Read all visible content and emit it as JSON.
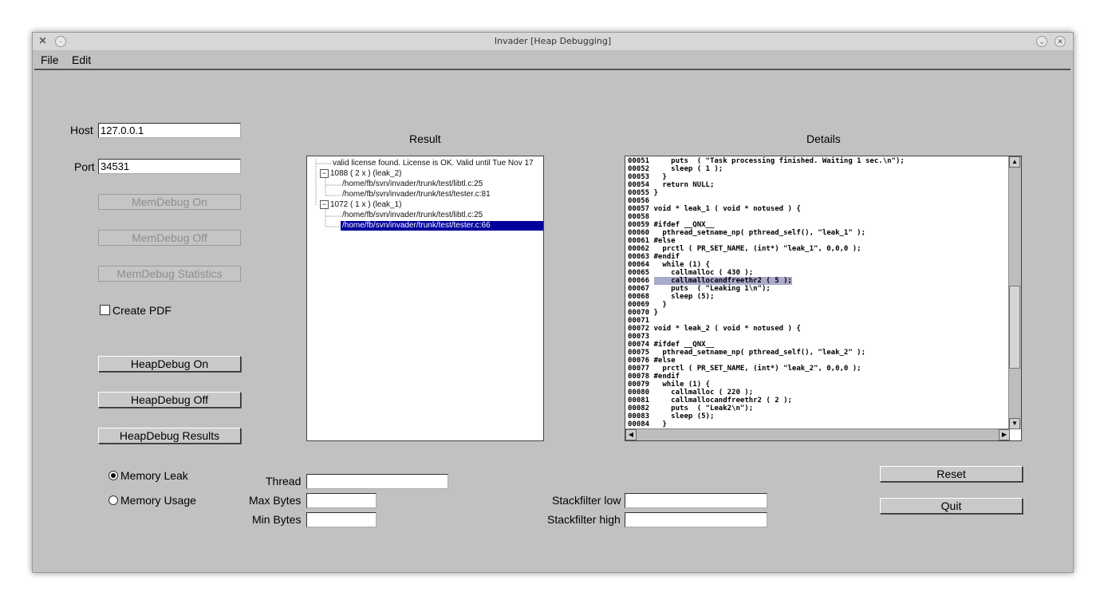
{
  "window": {
    "title": "Invader [Heap Debugging]"
  },
  "menu": {
    "file": "File",
    "edit": "Edit"
  },
  "connection": {
    "host_label": "Host",
    "host_value": "127.0.0.1",
    "port_label": "Port",
    "port_value": "34531"
  },
  "buttons": {
    "memdebug_on": "MemDebug On",
    "memdebug_off": "MemDebug Off",
    "memdebug_stats": "MemDebug Statistics",
    "heapdebug_on": "HeapDebug On",
    "heapdebug_off": "HeapDebug Off",
    "heapdebug_results": "HeapDebug Results",
    "reset": "Reset",
    "quit": "Quit"
  },
  "create_pdf": {
    "label": "Create PDF",
    "checked": false
  },
  "result": {
    "header": "Result",
    "rows": [
      "valid license found.  License is OK. Valid until Tue Nov 17",
      "1088 ( 2 x ) (leak_2)",
      "/home/fb/svn/invader/trunk/test/libtl.c:25",
      "/home/fb/svn/invader/trunk/test/tester.c:81",
      "1072 ( 1 x ) (leak_1)",
      "/home/fb/svn/invader/trunk/test/libtl.c:25",
      "/home/fb/svn/invader/trunk/test/tester.c:66"
    ],
    "toggle_collapse": "−"
  },
  "details": {
    "header": "Details",
    "lines": [
      "00051     puts  ( \"Task processing finished. Waiting 1 sec.\\n\");",
      "00052     sleep ( 1 );",
      "00053   }",
      "00054   return NULL;",
      "00055 }",
      "00056",
      "00057 void * leak_1 ( void * notused ) {",
      "00058",
      "00059 #ifdef __QNX__",
      "00060   pthread_setname_np( pthread_self(), \"leak_1\" );",
      "00061 #else",
      "00062   prctl ( PR_SET_NAME, (int*) \"leak_1\", 0,0,0 );",
      "00063 #endif",
      "00064   while (1) {",
      "00065     callmalloc ( 430 );",
      "00066     callmallocandfreethr2 ( 5 );",
      "00067     puts  ( \"Leaking 1\\n\");",
      "00068     sleep (5);",
      "00069   }",
      "00070 }",
      "00071",
      "00072 void * leak_2 ( void * notused ) {",
      "00073",
      "00074 #ifdef __QNX__",
      "00075   pthread_setname_np( pthread_self(), \"leak_2\" );",
      "00076 #else",
      "00077   prctl ( PR_SET_NAME, (int*) \"leak_2\", 0,0,0 );",
      "00078 #endif",
      "00079   while (1) {",
      "00080     callmalloc ( 220 );",
      "00081     callmallocandfreethr2 ( 2 );",
      "00082     puts  ( \"Leak2\\n\");",
      "00083     sleep (5);",
      "00084   }"
    ],
    "highlight_line": "00066"
  },
  "mode": {
    "memory_leak": "Memory Leak",
    "memory_usage": "Memory Usage",
    "selected": "memory_leak"
  },
  "filters": {
    "thread_label": "Thread",
    "thread_value": "",
    "max_bytes_label": "Max Bytes",
    "max_bytes_value": "",
    "min_bytes_label": "Min Bytes",
    "min_bytes_value": "",
    "stack_low_label": "Stackfilter low",
    "stack_low_value": "",
    "stack_high_label": "Stackfilter high",
    "stack_high_value": ""
  }
}
